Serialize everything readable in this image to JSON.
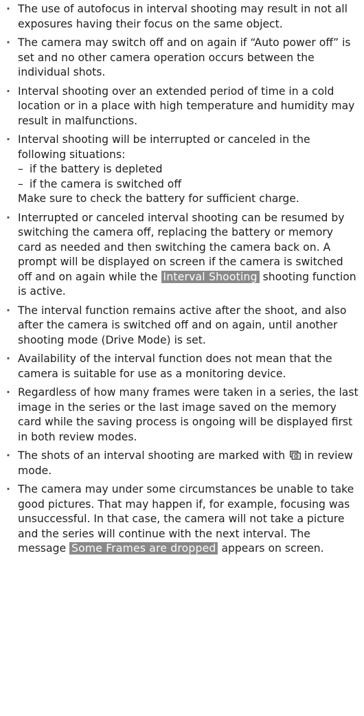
{
  "notes": [
    {
      "text": "The use of autofocus in interval shooting may result in not all exposures having their focus on the same object."
    },
    {
      "text": "The camera may switch off and on again if “Auto power off” is set and no other camera operation occurs between the individual shots."
    },
    {
      "text": "Interval shooting over an extended period of time in a cold location or in a place with high temperature and humidity may result in malfunctions."
    },
    {
      "text": "Interval shooting will be interrupted or canceled in the following situations:",
      "sub_items": [
        "if the battery is depleted",
        "if the camera is switched off"
      ],
      "continuation": "Make sure to check the battery for sufficient charge."
    },
    {
      "text_before": "Interrupted or canceled interval shooting can be resumed by switching the camera off, replacing the battery or memory card as needed and then switching the camera back on. A prompt will be displayed on screen if the camera is switched off and on again while the",
      "highlight": "Interval Shooting",
      "text_after": "shooting function is active."
    },
    {
      "text": "The interval function remains active after the shoot, and also after the camera is switched off and on again, until another shooting mode (Drive Mode) is set."
    },
    {
      "text": "Availability of the interval function does not mean that the camera is suitable for use as a monitoring device."
    },
    {
      "text": "Regardless of how many frames were taken in a series, the last image in the series or the last image saved on the memory card while the saving process is ongoing will be displayed first in both review modes."
    },
    {
      "text_before": "The shots of an interval shooting are marked with",
      "icon": "interval-shooting-icon",
      "text_after": "in review mode."
    },
    {
      "text_before": "The camera may under some circumstances be unable to take good pictures. That may happen if, for example, focusing was unsuccessful. In that case, the camera will not take a picture and the series will continue with the next interval. The message",
      "highlight": "Some Frames are dropped",
      "text_after": "appears on screen."
    }
  ],
  "colors": {
    "text": "#1e1e1e",
    "highlight_bg": "#8a8a8a",
    "highlight_text": "#ffffff"
  }
}
